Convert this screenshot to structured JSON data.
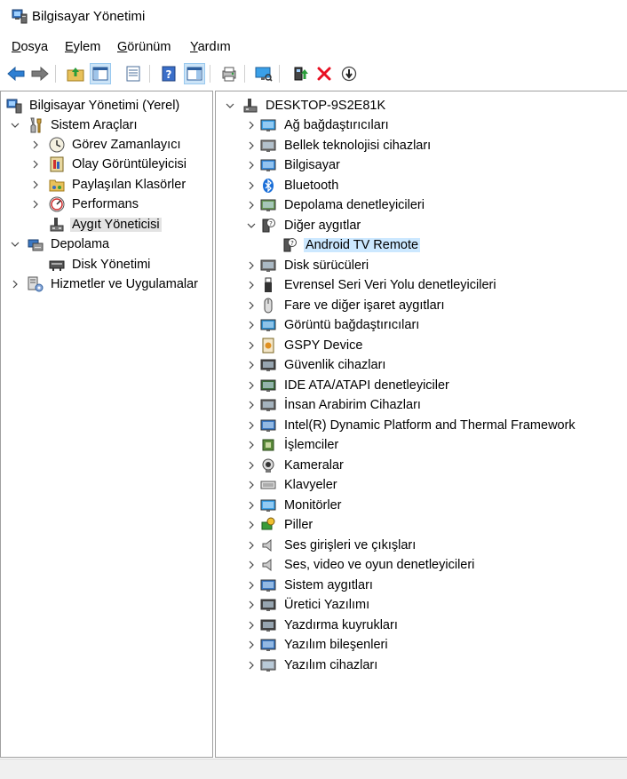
{
  "window": {
    "title": "Bilgisayar Yönetimi"
  },
  "menu": {
    "items": [
      "Dosya",
      "Eylem",
      "Görünüm",
      "Yardım"
    ]
  },
  "left_tree": {
    "root": "Bilgisayar Yönetimi (Yerel)",
    "system_tools": "Sistem Araçları",
    "task_scheduler": "Görev Zamanlayıcı",
    "event_viewer": "Olay Görüntüleyicisi",
    "shared_folders": "Paylaşılan Klasörler",
    "performance": "Performans",
    "device_manager": "Aygıt Yöneticisi",
    "storage": "Depolama",
    "disk_management": "Disk Yönetimi",
    "services_apps": "Hizmetler ve Uygulamalar"
  },
  "device_tree": {
    "computer_name": "DESKTOP-9S2E81K",
    "categories": [
      "Ağ bağdaştırıcıları",
      "Bellek teknolojisi cihazları",
      "Bilgisayar",
      "Bluetooth",
      "Depolama denetleyicileri",
      "Diğer aygıtlar",
      "Android TV Remote",
      "Disk sürücüleri",
      "Evrensel Seri Veri Yolu denetleyicileri",
      "Fare ve diğer işaret aygıtları",
      "Görüntü bağdaştırıcıları",
      "GSPY Device",
      "Güvenlik cihazları",
      "IDE ATA/ATAPI denetleyiciler",
      "İnsan Arabirim Cihazları",
      "Intel(R) Dynamic Platform and Thermal Framework",
      "İşlemciler",
      "Kameralar",
      "Klavyeler",
      "Monitörler",
      "Piller",
      "Ses girişleri ve çıkışları",
      "Ses, video ve oyun denetleyicileri",
      "Sistem aygıtları",
      "Üretici Yazılımı",
      "Yazdırma kuyrukları",
      "Yazılım bileşenleri",
      "Yazılım cihazları"
    ]
  },
  "colors": {
    "selection_blue": "#cce8ff",
    "selection_gray": "#e3e3e3",
    "accent": "#0078d7",
    "delete_red": "#e81123"
  },
  "icons": [
    "back-arrow-icon",
    "forward-arrow-icon",
    "up-folder-icon",
    "show-hide-tree-icon",
    "properties-icon",
    "help-icon",
    "action-pane-icon",
    "scan-hardware-icon",
    "monitor-icon",
    "update-driver-icon",
    "uninstall-icon",
    "disable-device-icon"
  ]
}
